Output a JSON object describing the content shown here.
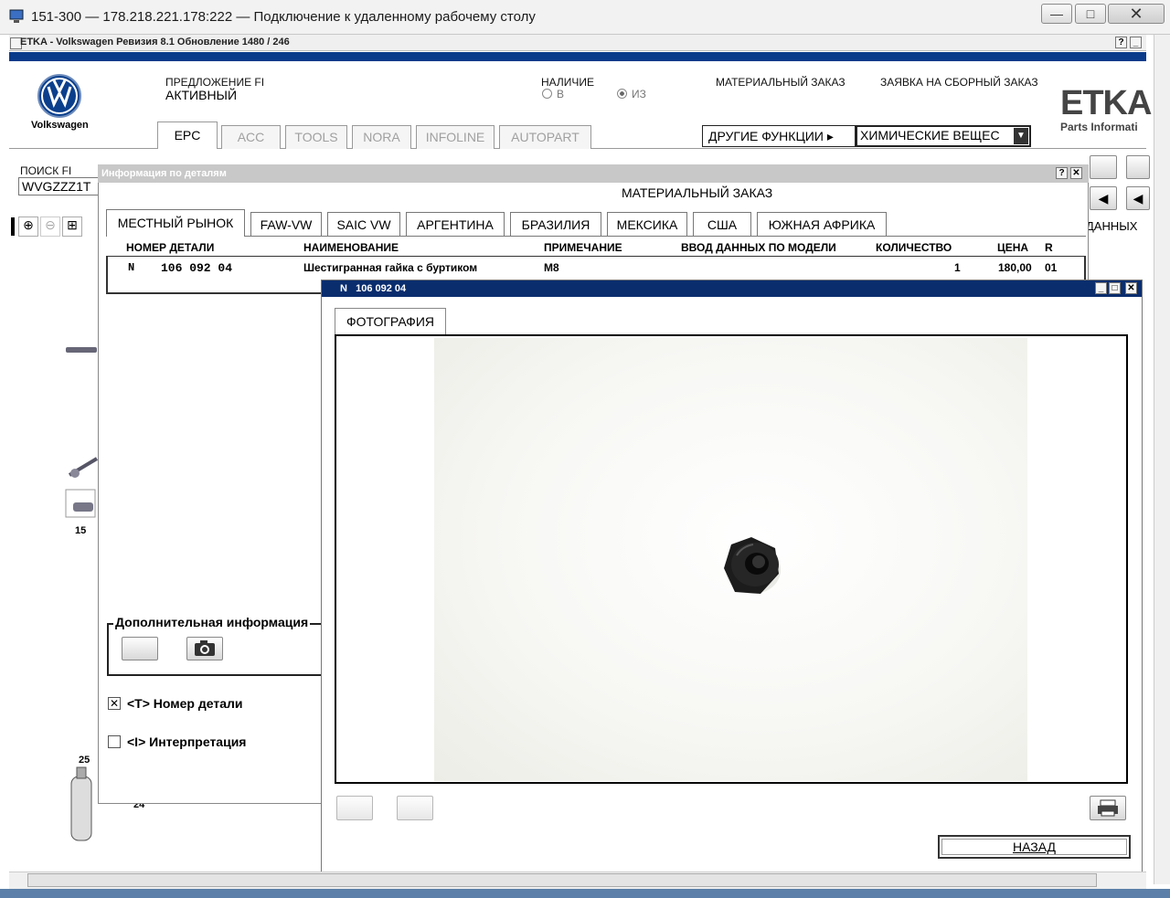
{
  "rdp": {
    "title": "151-300 — 178.218.221.178:222 — Подключение к удаленному рабочему столу"
  },
  "app": {
    "title": "ETKA - Volkswagen Ревизия 8.1 Обновление 1480 / 246"
  },
  "header": {
    "brand": "Volkswagen",
    "offer_label": "ПРЕДЛОЖЕНИЕ FI",
    "offer_value": "АКТИВНЫЙ",
    "availability_label": "НАЛИЧИЕ",
    "radio_in": "В",
    "radio_from": "ИЗ",
    "material_order": "МАТЕРИАЛЬНЫЙ ЗАКАЗ",
    "assembly_order": "ЗАЯВКА НА СБОРНЫЙ ЗАКАЗ",
    "etka_logo": "ETKA",
    "etka_sub": "Parts Informati",
    "other_functions": "ДРУГИЕ ФУНКЦИИ",
    "chemicals": "ХИМИЧЕСКИЕ ВЕЩЕС"
  },
  "tabs": [
    "EPC",
    "ACC",
    "TOOLS",
    "NORA",
    "INFOLINE",
    "AUTOPART"
  ],
  "search": {
    "label": "ПОИСК FI",
    "value": "WVGZZZ1T"
  },
  "right_panel": {
    "partial": "ДАННЫХ"
  },
  "diagram_labels": {
    "n15": "15",
    "n25": "25",
    "n24": "24"
  },
  "details_dialog": {
    "title": "Информация по деталям",
    "heading": "МАТЕРИАЛЬНЫЙ ЗАКАЗ",
    "market_tabs": [
      "МЕСТНЫЙ РЫНОК",
      "FAW-VW",
      "SAIC VW",
      "АРГЕНТИНА",
      "БРАЗИЛИЯ",
      "МЕКСИКА",
      "США",
      "ЮЖНАЯ АФРИКА"
    ],
    "columns": [
      "НОМЕР ДЕТАЛИ",
      "НАИМЕНОВАНИЕ",
      "ПРИМЕЧАНИЕ",
      "ВВОД ДАННЫХ ПО МОДЕЛИ",
      "КОЛИЧЕСТВО",
      "ЦЕНА",
      "R"
    ],
    "row": {
      "prefix": "N",
      "part_no": "106 092 04",
      "name": "Шестигранная гайка с буртиком",
      "note": "M8",
      "model": "",
      "qty": "1",
      "price": "180,00",
      "r": "01"
    },
    "extra_info": "Дополнительная информация",
    "opt_part_no": "<T> Номер детали",
    "opt_interp": "<I> Интерпретация"
  },
  "photo_dialog": {
    "title": "N   106 092 04",
    "tab": "ФОТОГРАФИЯ",
    "back": "НАЗАД"
  }
}
